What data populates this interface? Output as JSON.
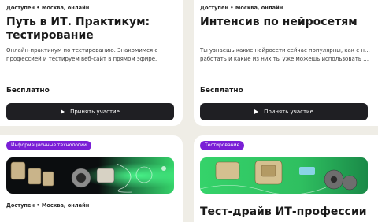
{
  "cards": [
    {
      "meta": "Доступен • Москва, онлайн",
      "title": "Путь в ИТ. Практикум: тестирование",
      "desc": "Онлайн-практикум по тестированию. Знакомимся с профессией и тестируем веб-сайт в прямом эфире.",
      "price": "Бесплатно",
      "button": "Принять участие"
    },
    {
      "meta": "Доступен • Москва, онлайн",
      "title": "Интенсив по нейросетям",
      "desc_line1": "Ты узнаешь какие нейросети сейчас популярны, как с ними",
      "desc_line2": "работать и какие из них ты уже можешь использовать для...",
      "price": "Бесплатно",
      "button": "Принять участие"
    },
    {
      "tag": "Информационные технологии",
      "tag_color": "#7a1fd6",
      "meta": "Доступен • Москва, онлайн",
      "title": ""
    },
    {
      "tag": "Тестирование",
      "tag_color": "#7a1fd6",
      "meta": "",
      "title": "Тест-драйв ИТ-профессии"
    }
  ],
  "icons": {
    "button": "play-icon"
  },
  "colors": {
    "background": "#efede6",
    "button": "#1f1f23",
    "accent": "#7a1fd6",
    "banner_green": "#35d36a"
  }
}
